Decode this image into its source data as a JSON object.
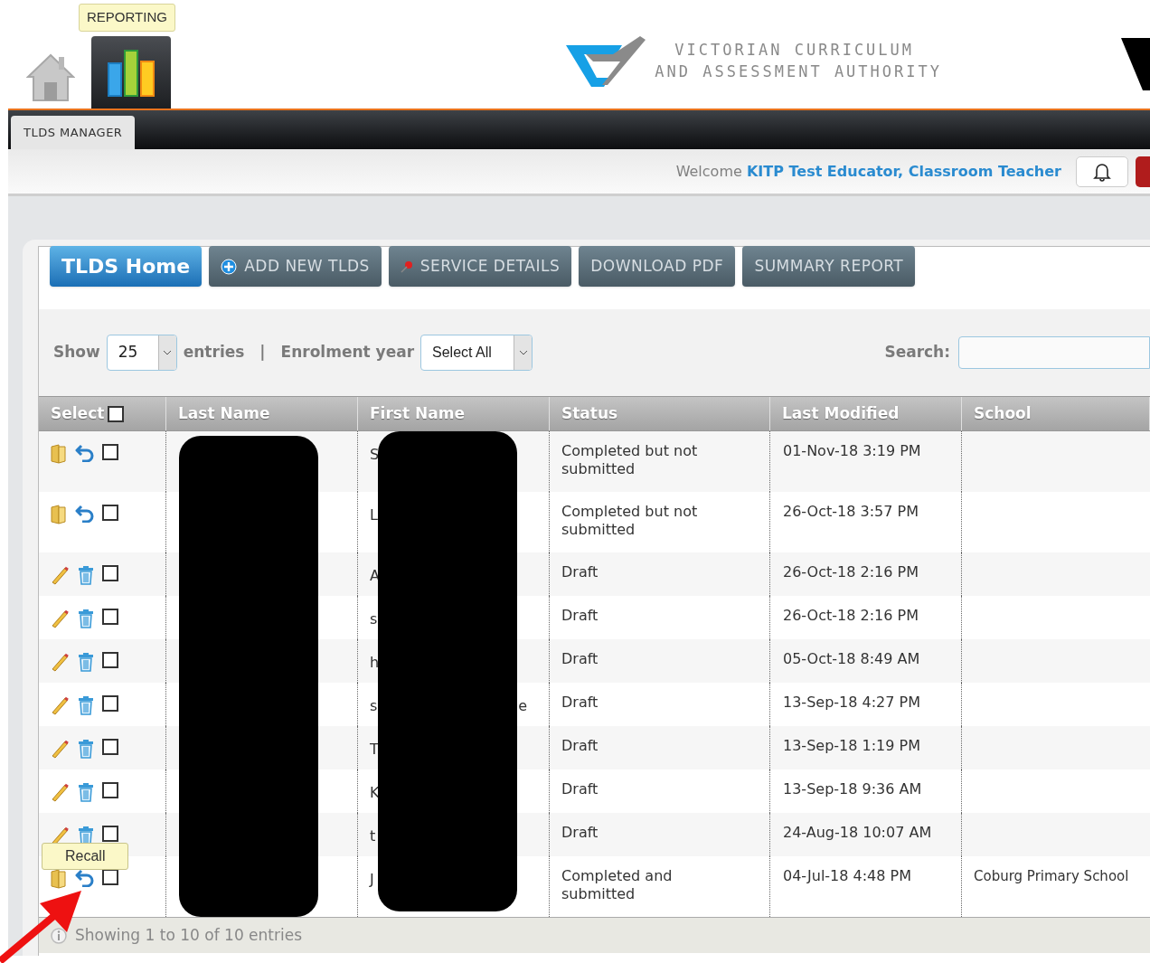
{
  "header": {
    "nav": [
      {
        "kind": "home",
        "selected": false
      },
      {
        "kind": "reporting",
        "selected": true,
        "tooltip": "REPORTING"
      }
    ],
    "logo_lines": [
      "VICTORIAN CURRICULUM",
      "AND ASSESSMENT AUTHORITY"
    ]
  },
  "tabs": [
    {
      "label": "TLDS MANAGER",
      "selected": true
    }
  ],
  "welcome": {
    "prefix": "Welcome",
    "user": "KITP Test Educator, Classroom Teacher"
  },
  "toolbar": [
    {
      "label": "TLDS Home",
      "selected": true,
      "kind": "plain"
    },
    {
      "label": "ADD NEW TLDS",
      "selected": false,
      "kind": "plus"
    },
    {
      "label": "SERVICE DETAILS",
      "selected": false,
      "kind": "pin"
    },
    {
      "label": "DOWNLOAD PDF",
      "selected": false,
      "kind": "plain"
    },
    {
      "label": "SUMMARY REPORT",
      "selected": false,
      "kind": "plain"
    }
  ],
  "filters": {
    "show_label": "Show",
    "page_size": "25",
    "entries_label": "entries",
    "separator": "|",
    "year_label": "Enrolment year",
    "year_value": "Select All",
    "search_label": "Search:"
  },
  "table": {
    "columns": [
      "Select",
      "Last Name",
      "First Name",
      "Status",
      "Last Modified",
      "School"
    ],
    "select_all_checked": false,
    "rows": [
      {
        "kind": "completed",
        "checked": false,
        "first_name": "S",
        "status": "Completed but not submitted",
        "last_modified": "01-Nov-18 3:19 PM"
      },
      {
        "kind": "completed",
        "checked": false,
        "first_name": "L",
        "status": "Completed but not submitted",
        "last_modified": "26-Oct-18 3:57 PM"
      },
      {
        "kind": "draft",
        "checked": false,
        "first_name": "A",
        "status": "Draft",
        "last_modified": "26-Oct-18 2:16 PM"
      },
      {
        "kind": "draft",
        "checked": false,
        "first_name": "s",
        "status": "Draft",
        "last_modified": "26-Oct-18 2:16 PM"
      },
      {
        "kind": "draft",
        "checked": false,
        "first_name": "h",
        "status": "Draft",
        "last_modified": "05-Oct-18 8:49 AM"
      },
      {
        "kind": "draft",
        "checked": false,
        "first_name": "s",
        "first_name_tail": "e",
        "status": "Draft",
        "last_modified": "13-Sep-18 4:27 PM"
      },
      {
        "kind": "draft",
        "checked": false,
        "first_name": "T",
        "status": "Draft",
        "last_modified": "13-Sep-18 1:19 PM"
      },
      {
        "kind": "draft",
        "checked": false,
        "first_name": "K",
        "status": "Draft",
        "last_modified": "13-Sep-18 9:36 AM"
      },
      {
        "kind": "draft",
        "checked": false,
        "first_name": "t",
        "status": "Draft",
        "last_modified": "24-Aug-18 10:07 AM"
      },
      {
        "kind": "completed",
        "checked": false,
        "first_name": "J",
        "status": "Completed and submitted",
        "last_modified": "04-Jul-18 4:48 PM",
        "school": "Coburg Primary School"
      }
    ],
    "footer": "Showing 1 to 10 of 10 entries"
  },
  "tooltip": {
    "text": "Recall"
  }
}
